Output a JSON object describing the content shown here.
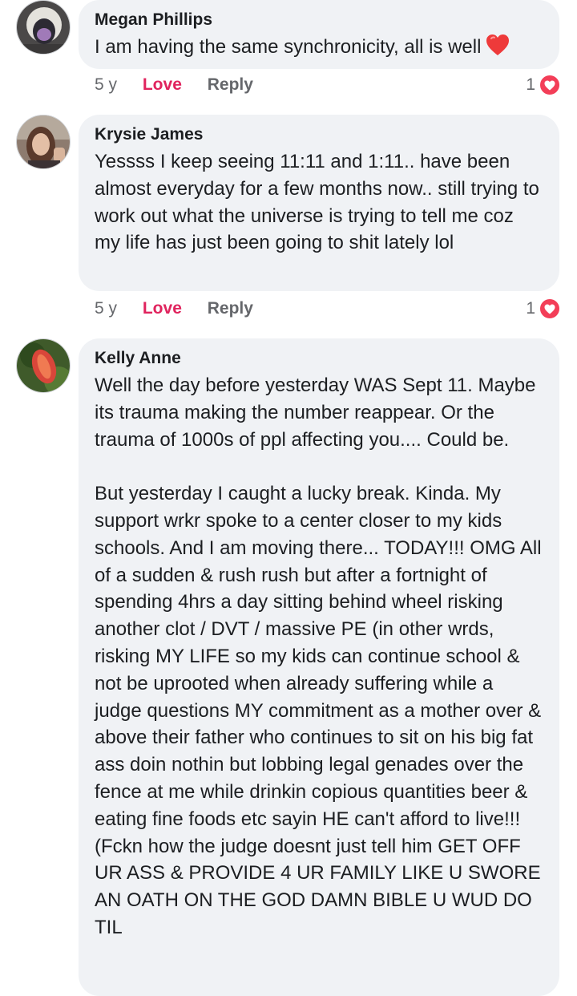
{
  "colors": {
    "bubble": "#f0f2f5",
    "love": "#e0245e",
    "reaction_heart": "#f33e58",
    "meta": "#65676b",
    "text": "#1c1e21"
  },
  "comments": [
    {
      "author": "Megan Phillips",
      "text": "I am having the same synchronicity, all is well",
      "emoji": "red-heart-icon",
      "time": "5 y",
      "love_label": "Love",
      "reply_label": "Reply",
      "reaction_count": "1",
      "reaction_icon": "heart-reaction-icon"
    },
    {
      "author": "Krysie James",
      "text": "Yessss I keep seeing 11:11 and 1:11.. have been almost everyday for a few months now.. still trying to work out what the universe is trying to tell me coz my life has just been going to shit lately lol",
      "time": "5 y",
      "love_label": "Love",
      "reply_label": "Reply",
      "reaction_count": "1",
      "reaction_icon": "heart-reaction-icon"
    },
    {
      "author": "Kelly Anne",
      "text": "Well the day before yesterday WAS Sept 11. Maybe its trauma making the number reappear. Or the trauma of 1000s of ppl affecting you.... Could be.\n\nBut yesterday I caught a lucky break. Kinda. My support wrkr spoke to a center closer to my kids schools. And I am moving there... TODAY!!! OMG All of a sudden & rush rush but after a fortnight of spending 4hrs a day sitting behind wheel risking another clot / DVT / massive PE (in other wrds, risking MY LIFE so my kids can continue school & not be uprooted when already suffering while a judge questions MY commitment as a mother over & above their father who continues to sit on his big fat ass doin nothin but lobbing legal genades over the fence at me while drinkin copious quantities beer & eating fine foods etc sayin HE can't afford to live!!! (Fckn how the judge doesnt just tell him GET OFF UR ASS & PROVIDE 4 UR FAMILY LIKE U SWORE AN OATH ON THE GOD DAMN BIBLE U WUD DO TIL"
    }
  ]
}
